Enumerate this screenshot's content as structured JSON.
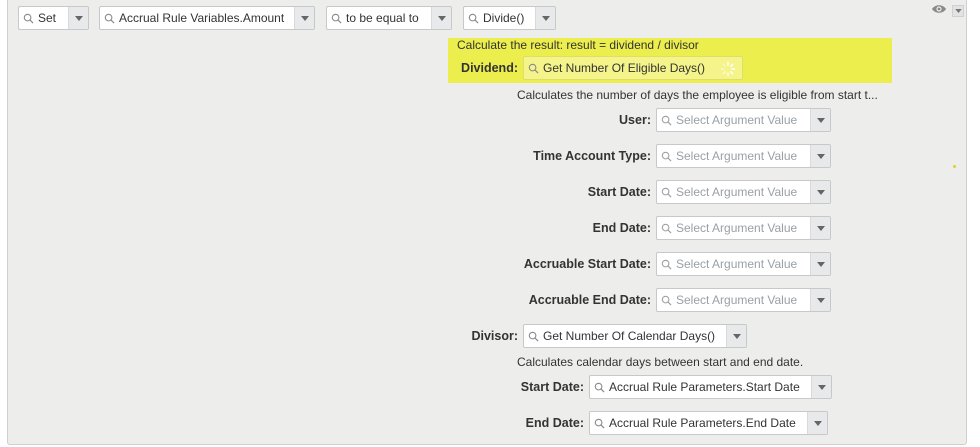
{
  "top_row": {
    "set": "Set",
    "target": "Accrual Rule Variables.Amount",
    "operator": "to be equal to",
    "function": "Divide()"
  },
  "divide": {
    "description": "Calculate the result: result = dividend / divisor",
    "dividend_label": "Dividend:",
    "dividend_value": "Get Number Of Eligible Days()",
    "eligible_description": "Calculates the number of days the employee is eligible from start t...",
    "args": [
      {
        "label": "User:",
        "placeholder": "Select Argument Value"
      },
      {
        "label": "Time Account Type:",
        "placeholder": "Select Argument Value"
      },
      {
        "label": "Start Date:",
        "placeholder": "Select Argument Value"
      },
      {
        "label": "End Date:",
        "placeholder": "Select Argument Value"
      },
      {
        "label": "Accruable Start Date:",
        "placeholder": "Select Argument Value"
      },
      {
        "label": "Accruable End Date:",
        "placeholder": "Select Argument Value"
      }
    ],
    "divisor_label": "Divisor:",
    "divisor_value": "Get Number Of Calendar Days()",
    "calendar_description": "Calculates calendar days between start and end date.",
    "calendar_args": [
      {
        "label": "Start Date:",
        "value": "Accrual Rule Parameters.Start Date"
      },
      {
        "label": "End Date:",
        "value": "Accrual Rule Parameters.End Date"
      }
    ]
  },
  "colors": {
    "highlight": "#ecee4e",
    "panel_bg": "#ededeb"
  },
  "icons": {
    "search": "search-icon",
    "dropdown": "chevron-down-icon",
    "visibility": "eye-icon",
    "loading": "spinner-icon"
  }
}
